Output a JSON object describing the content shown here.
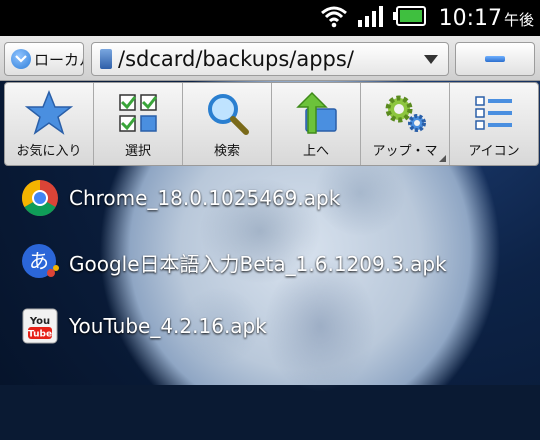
{
  "status_bar": {
    "time": "10:17",
    "time_suffix": "午後",
    "icons": [
      "wifi-icon",
      "signal-icon",
      "battery-icon"
    ]
  },
  "path_bar": {
    "location_button_label": "ローカル",
    "current_path": "/sdcard/backups/apps/"
  },
  "toolbar": {
    "items": [
      {
        "label": "お気に入り",
        "icon": "star-icon"
      },
      {
        "label": "選択",
        "icon": "checklist-icon"
      },
      {
        "label": "検索",
        "icon": "search-icon"
      },
      {
        "label": "上へ",
        "icon": "up-folder-icon"
      },
      {
        "label": "アップ・マ",
        "icon": "gears-icon"
      },
      {
        "label": "アイコン",
        "icon": "list-view-icon"
      }
    ]
  },
  "files": [
    {
      "name": "Chrome_18.0.1025469.apk",
      "icon": "chrome-icon"
    },
    {
      "name": "Google日本語入力Beta_1.6.1209.3.apk",
      "icon": "google-japanese-input-icon"
    },
    {
      "name": "YouTube_4.2.16.apk",
      "icon": "youtube-icon"
    }
  ],
  "colors": {
    "status_bar_bg": "#000000",
    "toolbar_bg": "#e8e8e8",
    "accent_blue": "#2c6fce",
    "battery_green": "#3fbf3f"
  }
}
